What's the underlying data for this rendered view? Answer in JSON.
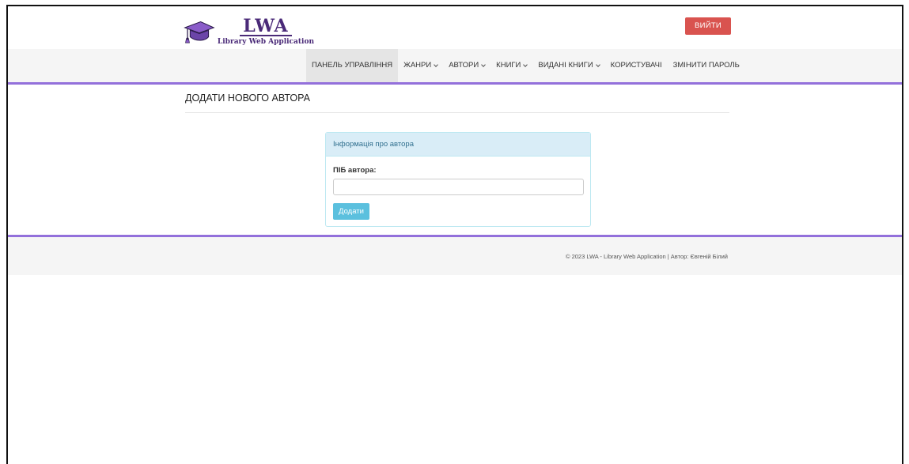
{
  "header": {
    "logo": {
      "title": "LWA",
      "subtitle": "Library Web Application",
      "icon": "graduation-cap-icon"
    },
    "logout_label": "ВИЙТИ"
  },
  "nav": {
    "items": [
      {
        "label": "ПАНЕЛЬ УПРАВЛІННЯ",
        "dropdown": false,
        "active": true
      },
      {
        "label": "ЖАНРИ",
        "dropdown": true
      },
      {
        "label": "АВТОРИ",
        "dropdown": true
      },
      {
        "label": "КНИГИ",
        "dropdown": true
      },
      {
        "label": "ВИДАНІ КНИГИ",
        "dropdown": true
      },
      {
        "label": "КОРИСТУВАЧІ",
        "dropdown": false
      },
      {
        "label": "ЗМІНИТИ ПАРОЛЬ",
        "dropdown": false
      }
    ]
  },
  "main": {
    "page_title": "ДОДАТИ НОВОГО АВТОРА",
    "panel": {
      "heading": "Інформація про автора",
      "field_label": "ПІБ автора:",
      "field_value": "",
      "submit_label": "Додати"
    }
  },
  "footer": {
    "text": "© 2023 LWA - Library Web Application | Автор: Євгеній Білий"
  },
  "colors": {
    "accent": "#9370db",
    "danger": "#d9534f",
    "info": "#5bc0de",
    "panel_heading": "#d9edf7"
  }
}
